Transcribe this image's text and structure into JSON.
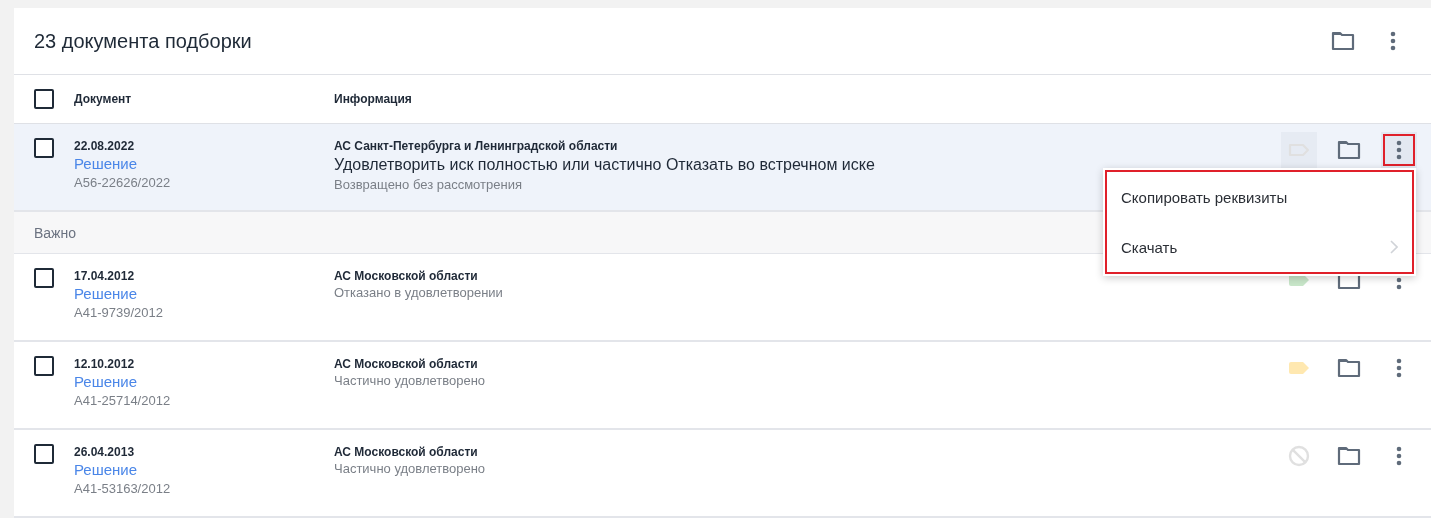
{
  "header": {
    "title": "23 документа подборки"
  },
  "columns": [
    {
      "label": "Документ"
    },
    {
      "label": "Информация"
    }
  ],
  "select_all": {
    "checked": false
  },
  "rows": [
    {
      "checked": false,
      "selected": true,
      "menu_open": true,
      "date": "22.08.2022",
      "doc_type": "Решение",
      "case_number": "А56-22626/2022",
      "court": "АС Санкт-Петербурга и Ленинградской области",
      "decision": "Удовлетворить иск полностью или частично Отказать во встречном иске",
      "status": "Возвращено без рассмотрения",
      "tag": {
        "kind": "outline",
        "color": "#e0e0e0"
      }
    },
    {
      "kind": "group",
      "label": "Важно"
    },
    {
      "checked": false,
      "selected": false,
      "menu_open": false,
      "date": "17.04.2012",
      "doc_type": "Решение",
      "case_number": "А41-9739/2012",
      "court": "АС Московской области",
      "status": "Отказано в удовлетворении",
      "tag": {
        "kind": "filled",
        "color": "#c8e6c9"
      }
    },
    {
      "checked": false,
      "selected": false,
      "menu_open": false,
      "date": "12.10.2012",
      "doc_type": "Решение",
      "case_number": "А41-25714/2012",
      "court": "АС Московской области",
      "status": "Частично удовлетворено",
      "tag": {
        "kind": "filled",
        "color": "#ffe8b0"
      }
    },
    {
      "checked": false,
      "selected": false,
      "menu_open": false,
      "date": "26.04.2013",
      "doc_type": "Решение",
      "case_number": "А41-53163/2012",
      "court": "АС Московской области",
      "status": "Частично удовлетворено",
      "tag": {
        "kind": "none",
        "color": "#e0e0e0"
      }
    }
  ],
  "menu": {
    "highlighted": true,
    "items": [
      {
        "label": "Скопировать реквизиты",
        "has_submenu": false
      },
      {
        "label": "Скачать",
        "has_submenu": true
      }
    ]
  }
}
